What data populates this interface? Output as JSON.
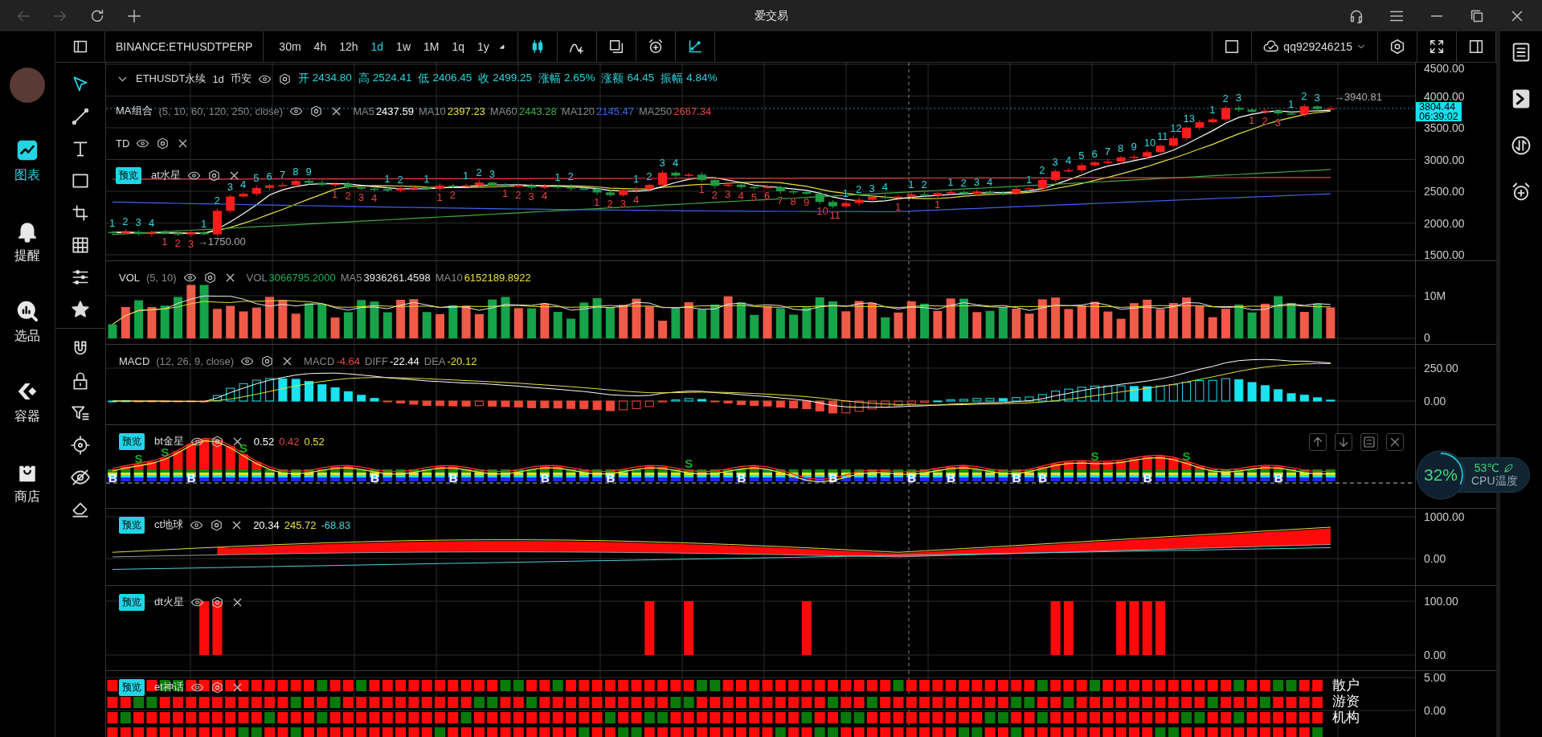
{
  "window": {
    "title": "爱交易"
  },
  "app_sidebar": {
    "items": [
      {
        "label": "图表",
        "kind": "chart",
        "selected": true
      },
      {
        "label": "提醒",
        "kind": "bell",
        "selected": false
      },
      {
        "label": "选品",
        "kind": "search",
        "selected": false
      },
      {
        "label": "容器",
        "kind": "container",
        "selected": false
      },
      {
        "label": "商店",
        "kind": "shop",
        "selected": false
      }
    ]
  },
  "toolbar": {
    "symbol": "BINANCE:ETHUSDTPERP",
    "intervals": [
      {
        "label": "30m",
        "selected": false
      },
      {
        "label": "4h",
        "selected": false
      },
      {
        "label": "12h",
        "selected": false
      },
      {
        "label": "1d",
        "selected": true
      },
      {
        "label": "1w",
        "selected": false
      },
      {
        "label": "1M",
        "selected": false
      },
      {
        "label": "1q",
        "selected": false
      },
      {
        "label": "1y",
        "selected": false
      }
    ],
    "tools": [
      {
        "kind": "candles",
        "selected": true
      },
      {
        "kind": "indicator",
        "selected": false
      },
      {
        "kind": "layout",
        "selected": false
      },
      {
        "kind": "alarm",
        "selected": false
      },
      {
        "kind": "draw",
        "selected": true
      }
    ],
    "account": "qq929246215"
  },
  "drawing_tools": [
    [
      {
        "kind": "cursor",
        "selected": true
      },
      {
        "kind": "line",
        "selected": false
      },
      {
        "kind": "text",
        "selected": false
      },
      {
        "kind": "rect",
        "selected": false
      },
      {
        "kind": "crop",
        "selected": false
      },
      {
        "kind": "grid",
        "selected": false
      },
      {
        "kind": "sliders",
        "selected": false
      },
      {
        "kind": "star",
        "selected": false
      }
    ],
    [
      {
        "kind": "magnet",
        "selected": false
      },
      {
        "kind": "lock",
        "selected": false
      },
      {
        "kind": "filter",
        "selected": false
      },
      {
        "kind": "target",
        "selected": false
      },
      {
        "kind": "eyeoff",
        "selected": false
      },
      {
        "kind": "eraser",
        "selected": false
      }
    ]
  ],
  "right_sidebar": {
    "items": [
      {
        "kind": "menubox"
      },
      {
        "kind": "flag"
      },
      {
        "kind": "swap"
      },
      {
        "kind": "alarm"
      }
    ]
  },
  "main_pane": {
    "symbol": "ETHUSDT永续",
    "interval": "1d",
    "exchange": "币安",
    "quote": [
      {
        "label": "开",
        "value": "2434.80"
      },
      {
        "label": "高",
        "value": "2524.41"
      },
      {
        "label": "低",
        "value": "2406.45"
      },
      {
        "label": "收",
        "value": "2499.25"
      },
      {
        "label": "涨幅",
        "value": "2.65%"
      },
      {
        "label": "涨额",
        "value": "64.45"
      },
      {
        "label": "振幅",
        "value": "4.84%"
      }
    ],
    "ma": {
      "name": "MA组合",
      "params": "(5, 10, 60, 120, 250, close)",
      "values": [
        {
          "label": "MA5",
          "value": "2437.59",
          "color": "#ffffff"
        },
        {
          "label": "MA10",
          "value": "2397.23",
          "color": "#e8e040"
        },
        {
          "label": "MA60",
          "value": "2443.28",
          "color": "#45a845"
        },
        {
          "label": "MA120",
          "value": "2145.47",
          "color": "#3f63e8"
        },
        {
          "label": "MA250",
          "value": "2667.34",
          "color": "#e84545"
        }
      ]
    },
    "td": {
      "name": "TD"
    },
    "at": {
      "badge": "预览",
      "name": "at水星"
    },
    "td_runs": [
      {
        "below": false,
        "labels": [
          "1",
          "2",
          "3",
          "4"
        ]
      },
      {
        "below": true,
        "labels": [
          "1",
          "2",
          "3"
        ]
      },
      {
        "below": false,
        "labels": [
          "1",
          "2",
          "3",
          "4",
          "5",
          "6",
          "7",
          "8",
          "9"
        ]
      },
      {
        "below": true,
        "labels": [
          "1",
          "2",
          "3",
          "4"
        ]
      },
      {
        "below": false,
        "labels": [
          "1",
          "2"
        ]
      },
      {
        "below": false,
        "labels": [
          "1"
        ]
      },
      {
        "below": true,
        "labels": [
          "1",
          "2"
        ]
      },
      {
        "below": false,
        "labels": [
          "1",
          "2",
          "3"
        ]
      },
      {
        "below": true,
        "labels": [
          "1",
          "2",
          "3",
          "4"
        ]
      },
      {
        "below": false,
        "labels": [
          "1",
          "2"
        ]
      },
      {
        "below": true,
        "labels": [
          "1",
          "2",
          "3",
          "4"
        ]
      },
      {
        "below": false,
        "labels": [
          "1",
          "2",
          "3",
          "4"
        ]
      },
      {
        "below": true,
        "labels": [
          "1",
          "2",
          "3",
          "4",
          "5",
          "6",
          "7",
          "8",
          "9",
          "10",
          "11"
        ]
      },
      {
        "below": false,
        "labels": [
          "1",
          "2",
          "3",
          "4"
        ]
      },
      {
        "below": true,
        "labels": [
          "1"
        ]
      },
      {
        "below": false,
        "labels": [
          "1",
          "2"
        ]
      },
      {
        "below": true,
        "labels": [
          "1"
        ]
      },
      {
        "below": false,
        "labels": [
          "1",
          "2",
          "3",
          "4"
        ]
      },
      {
        "below": false,
        "labels": [
          "1",
          "2",
          "3",
          "4",
          "5",
          "6",
          "7",
          "8",
          "9",
          "10",
          "11",
          "12",
          "13"
        ]
      },
      {
        "below": false,
        "labels": [
          "1",
          "2",
          "3"
        ]
      },
      {
        "below": true,
        "labels": [
          "1",
          "2",
          "3"
        ]
      },
      {
        "below": false,
        "labels": [
          "1",
          "2",
          "3"
        ]
      }
    ],
    "high_label": "→3940.81",
    "low_label": "→1750.00",
    "price_tag": {
      "price": "3804.44",
      "countdown": "06:39:02"
    },
    "axis": [
      "4500.00",
      "4000.00",
      "3500.00",
      "3000.00",
      "2500.00",
      "2000.00",
      "1500.00"
    ]
  },
  "vol_pane": {
    "name": "VOL",
    "params": "(5, 10)",
    "values": [
      {
        "label": "VOL",
        "value": "3066795.2000",
        "color": "#1fb35a"
      },
      {
        "label": "MA5",
        "value": "3936261.4598",
        "color": "#e8e8e8"
      },
      {
        "label": "MA10",
        "value": "6152189.8922",
        "color": "#e8e040"
      }
    ],
    "axis": [
      "10M",
      "0"
    ]
  },
  "macd_pane": {
    "name": "MACD",
    "params": "(12, 26, 9, close)",
    "values": [
      {
        "label": "MACD",
        "value": "-4.64",
        "color": "#e84545"
      },
      {
        "label": "DIFF",
        "value": "-22.44",
        "color": "#ffffff"
      },
      {
        "label": "DEA",
        "value": "-20.12",
        "color": "#e8e040"
      }
    ],
    "axis": [
      "250.00",
      "0.00"
    ]
  },
  "bt_pane": {
    "badge": "预览",
    "name": "bt金星",
    "values": [
      {
        "value": "0.52",
        "color": "#ffffff"
      },
      {
        "value": "0.42",
        "color": "#e84545"
      },
      {
        "value": "0.52",
        "color": "#e8e040"
      }
    ],
    "signals": [
      {
        "text": "B",
        "kind": "buy"
      },
      {
        "text": "S",
        "kind": "sell"
      },
      {
        "text": "S",
        "kind": "sell"
      },
      {
        "text": "B",
        "kind": "buy"
      },
      {
        "text": "S",
        "kind": "sell"
      },
      {
        "text": "B",
        "kind": "buy"
      },
      {
        "text": "B",
        "kind": "buy"
      },
      {
        "text": "B",
        "kind": "buy"
      },
      {
        "text": "B",
        "kind": "buy"
      },
      {
        "text": "S",
        "kind": "sell"
      },
      {
        "text": "B",
        "kind": "buy"
      },
      {
        "text": "B",
        "kind": "buy"
      },
      {
        "text": "B",
        "kind": "buy"
      },
      {
        "text": "B",
        "kind": "buy"
      },
      {
        "text": "B",
        "kind": "buy"
      },
      {
        "text": "B",
        "kind": "buy"
      },
      {
        "text": "S",
        "kind": "sell"
      },
      {
        "text": "B",
        "kind": "buy"
      },
      {
        "text": "S",
        "kind": "sell"
      },
      {
        "text": "B",
        "kind": "buy"
      }
    ],
    "pane_buttons": [
      {
        "kind": "up"
      },
      {
        "kind": "down"
      },
      {
        "kind": "maxpane"
      },
      {
        "kind": "x"
      }
    ]
  },
  "ct_pane": {
    "badge": "预览",
    "name": "ct地球",
    "values": [
      {
        "value": "20.34",
        "color": "#ffffff"
      },
      {
        "value": "245.72",
        "color": "#e8e040"
      },
      {
        "value": "-68.83",
        "color": "#4fd1d9"
      }
    ],
    "axis": [
      "1000.00",
      "0.00"
    ]
  },
  "dt_pane": {
    "badge": "预览",
    "name": "dt火星",
    "axis": [
      "100.00",
      "0.00"
    ]
  },
  "et_pane": {
    "badge": "预览",
    "name": "et神话",
    "row_labels": [
      "散户",
      "游资",
      "机构"
    ],
    "axis": [
      "5.00",
      "0.00"
    ]
  },
  "cpu_widget": {
    "load": "32%",
    "level": 0.32,
    "temperature": "53℃",
    "label": "CPU温度"
  }
}
